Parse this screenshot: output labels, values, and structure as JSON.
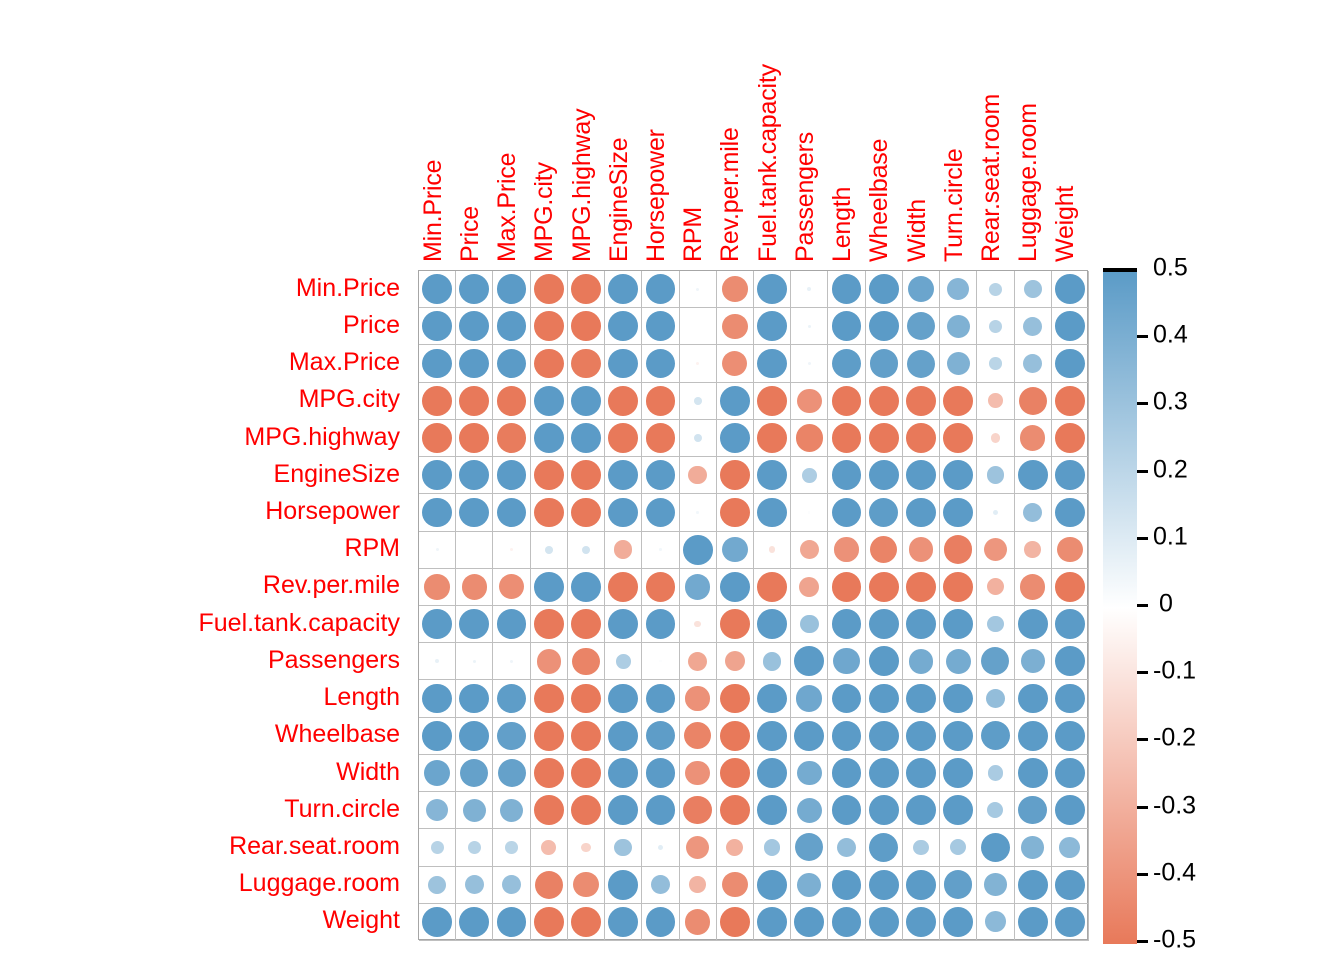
{
  "chart_data": {
    "type": "heatmap",
    "title": "",
    "subtitle": "",
    "xlabel": "",
    "ylabel": "",
    "grid": true,
    "legend_position": "right",
    "marker": "circle",
    "marker_size_scales_with_abs_value": true,
    "colorscale": {
      "min": -0.5,
      "max": 0.5,
      "neutral": 0,
      "low_color": "#e8795a",
      "mid_color": "#ffffff",
      "high_color": "#5b9bc7",
      "ticks": [
        "0.5",
        "0.4",
        "0.3",
        "0.2",
        "0.1",
        "0",
        "-0.1",
        "-0.2",
        "-0.3",
        "-0.4",
        "-0.5"
      ],
      "tick_values": [
        0.5,
        0.4,
        0.3,
        0.2,
        0.1,
        0,
        -0.1,
        -0.2,
        -0.3,
        -0.4,
        -0.5
      ]
    },
    "categories": [
      "Min.Price",
      "Price",
      "Max.Price",
      "MPG.city",
      "MPG.highway",
      "EngineSize",
      "Horsepower",
      "RPM",
      "Rev.per.mile",
      "Fuel.tank.capacity",
      "Passengers",
      "Length",
      "Wheelbase",
      "Width",
      "Turn.circle",
      "Rear.seat.room",
      "Luggage.room",
      "Weight"
    ],
    "row_labels": [
      "Min.Price",
      "Price",
      "Max.Price",
      "MPG.city",
      "MPG.highway",
      "EngineSize",
      "Horsepower",
      "RPM",
      "Rev.per.mile",
      "Fuel.tank.capacity",
      "Passengers",
      "Length",
      "Wheelbase",
      "Width",
      "Turn.circle",
      "Rear.seat.room",
      "Luggage.room",
      "Weight"
    ],
    "column_labels": [
      "Min.Price",
      "Price",
      "Max.Price",
      "MPG.city",
      "MPG.highway",
      "EngineSize",
      "Horsepower",
      "RPM",
      "Rev.per.mile",
      "Fuel.tank.capacity",
      "Passengers",
      "Length",
      "Wheelbase",
      "Width",
      "Turn.circle",
      "Rear.seat.room",
      "Luggage.room",
      "Weight"
    ],
    "matrix": [
      [
        1.0,
        0.97,
        0.89,
        -0.62,
        -0.54,
        0.6,
        0.75,
        0.05,
        -0.43,
        0.59,
        0.07,
        0.5,
        0.5,
        0.45,
        0.37,
        0.22,
        0.3,
        0.65
      ],
      [
        1.0,
        1.0,
        0.98,
        -0.59,
        -0.53,
        0.6,
        0.79,
        0.0,
        -0.43,
        0.62,
        0.06,
        0.5,
        0.5,
        0.47,
        0.39,
        0.22,
        0.32,
        0.65
      ],
      [
        0.89,
        0.98,
        1.0,
        -0.56,
        -0.49,
        0.59,
        0.8,
        -0.05,
        -0.42,
        0.61,
        0.05,
        0.49,
        0.48,
        0.47,
        0.39,
        0.21,
        0.32,
        0.63
      ],
      [
        -0.62,
        -0.59,
        -0.56,
        1.0,
        0.94,
        -0.71,
        -0.67,
        0.13,
        0.62,
        -0.8,
        -0.41,
        -0.67,
        -0.67,
        -0.72,
        -0.65,
        -0.25,
        -0.47,
        -0.84
      ],
      [
        -0.54,
        -0.53,
        -0.49,
        0.94,
        1.0,
        -0.63,
        -0.62,
        0.14,
        0.59,
        -0.77,
        -0.46,
        -0.63,
        -0.64,
        -0.69,
        -0.61,
        -0.16,
        -0.43,
        -0.81
      ],
      [
        0.6,
        0.6,
        0.59,
        -0.71,
        -0.63,
        1.0,
        0.73,
        -0.31,
        -0.73,
        0.75,
        0.25,
        0.78,
        0.73,
        0.87,
        0.75,
        0.3,
        0.6,
        0.85
      ],
      [
        0.75,
        0.79,
        0.8,
        -0.67,
        -0.62,
        0.73,
        1.0,
        0.04,
        -0.6,
        0.7,
        0.01,
        0.55,
        0.49,
        0.64,
        0.51,
        0.09,
        0.33,
        0.74
      ],
      [
        0.05,
        0.0,
        -0.05,
        0.13,
        0.14,
        -0.31,
        0.04,
        1.0,
        0.43,
        -0.11,
        -0.33,
        -0.41,
        -0.46,
        -0.41,
        -0.48,
        -0.39,
        -0.28,
        -0.43
      ],
      [
        -0.43,
        -0.43,
        -0.42,
        0.62,
        0.59,
        -0.73,
        -0.6,
        0.43,
        1.0,
        -0.61,
        -0.34,
        -0.66,
        -0.68,
        -0.71,
        -0.68,
        -0.29,
        -0.43,
        -0.75
      ],
      [
        0.59,
        0.62,
        0.61,
        -0.8,
        -0.77,
        0.75,
        0.7,
        -0.11,
        -0.61,
        1.0,
        0.31,
        0.7,
        0.73,
        0.78,
        0.66,
        0.28,
        0.56,
        0.89
      ],
      [
        0.07,
        0.06,
        0.05,
        -0.41,
        -0.46,
        0.25,
        0.01,
        -0.33,
        -0.34,
        0.31,
        1.0,
        0.44,
        0.51,
        0.42,
        0.42,
        0.47,
        0.4,
        0.54
      ],
      [
        0.5,
        0.5,
        0.49,
        -0.67,
        -0.63,
        0.78,
        0.55,
        -0.41,
        -0.66,
        0.7,
        0.44,
        1.0,
        0.82,
        0.82,
        0.74,
        0.33,
        0.58,
        0.81
      ],
      [
        0.5,
        0.5,
        0.48,
        -0.67,
        -0.64,
        0.73,
        0.49,
        -0.46,
        -0.68,
        0.73,
        0.51,
        0.82,
        1.0,
        0.81,
        0.75,
        0.49,
        0.58,
        0.81
      ],
      [
        0.45,
        0.47,
        0.47,
        -0.72,
        -0.69,
        0.87,
        0.64,
        -0.41,
        -0.71,
        0.78,
        0.42,
        0.82,
        0.81,
        1.0,
        0.78,
        0.26,
        0.59,
        0.87
      ],
      [
        0.37,
        0.39,
        0.39,
        -0.65,
        -0.61,
        0.75,
        0.51,
        -0.48,
        -0.68,
        0.66,
        0.42,
        0.74,
        0.75,
        0.78,
        1.0,
        0.27,
        0.48,
        0.74
      ],
      [
        0.22,
        0.22,
        0.21,
        -0.25,
        -0.16,
        0.3,
        0.09,
        -0.39,
        -0.29,
        0.28,
        0.47,
        0.33,
        0.49,
        0.26,
        0.27,
        1.0,
        0.38,
        0.35
      ],
      [
        0.3,
        0.32,
        0.32,
        -0.47,
        -0.43,
        0.6,
        0.33,
        -0.28,
        -0.43,
        0.56,
        0.4,
        0.58,
        0.58,
        0.59,
        0.48,
        0.38,
        1.0,
        0.62
      ],
      [
        0.65,
        0.65,
        0.63,
        -0.84,
        -0.81,
        0.85,
        0.74,
        -0.43,
        -0.75,
        0.89,
        0.54,
        0.81,
        0.81,
        0.87,
        0.74,
        0.35,
        0.62,
        1.0
      ]
    ]
  },
  "axis": {
    "label_color": "#ff0000",
    "tick_color": "#000000"
  }
}
